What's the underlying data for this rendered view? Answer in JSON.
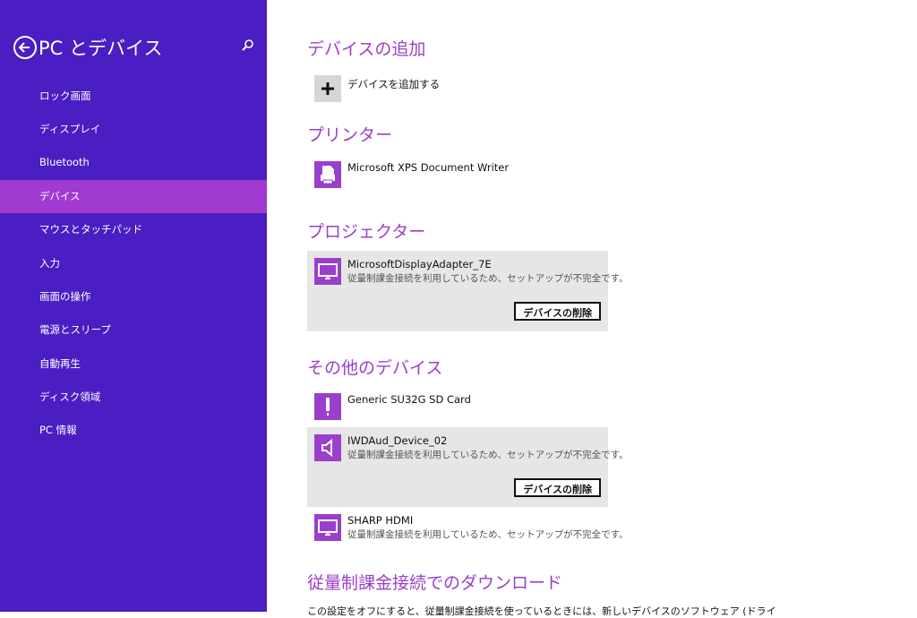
{
  "sidebar": {
    "title": "PC とデバイス",
    "items": [
      {
        "label": "ロック画面"
      },
      {
        "label": "ディスプレイ"
      },
      {
        "label": "Bluetooth"
      },
      {
        "label": "デバイス"
      },
      {
        "label": "マウスとタッチパッド"
      },
      {
        "label": "入力"
      },
      {
        "label": "画面の操作"
      },
      {
        "label": "電源とスリープ"
      },
      {
        "label": "自動再生"
      },
      {
        "label": "ディスク領域"
      },
      {
        "label": "PC 情報"
      }
    ]
  },
  "main": {
    "add_section": {
      "heading": "デバイスの追加",
      "add_label": "デバイスを追加する"
    },
    "printers": {
      "heading": "プリンター",
      "items": [
        {
          "name": "Microsoft XPS Document Writer"
        }
      ]
    },
    "projectors": {
      "heading": "プロジェクター",
      "items": [
        {
          "name": "MicrosoftDisplayAdapter_7E",
          "status": "従量制課金接続を利用しているため、セットアップが不完全です。",
          "button": "デバイスの削除"
        }
      ]
    },
    "other": {
      "heading": "その他のデバイス",
      "items": [
        {
          "name": "Generic SU32G SD Card"
        },
        {
          "name": "IWDAud_Device_02",
          "status": "従量制課金接続を利用しているため、セットアップが不完全です。",
          "button": "デバイスの削除"
        },
        {
          "name": "SHARP HDMI",
          "status": "従量制課金接続を利用しているため、セットアップが不完全です。"
        }
      ]
    },
    "metered": {
      "heading": "従量制課金接続でのダウンロード",
      "text": "この設定をオフにすると、従量制課金接続を使っているときには、新しいデバイスのソフトウェア (ドライ"
    }
  },
  "colors": {
    "sidebar_bg": "#4a1ec2",
    "sidebar_active": "#a03ad0",
    "accent": "#9a40c8",
    "selected_bg": "#e6e6e6"
  },
  "icons": {
    "back": "back-arrow-icon",
    "search": "search-icon",
    "add": "plus-icon",
    "printer": "printer-icon",
    "display": "monitor-icon",
    "sd_card": "sd-card-icon",
    "audio": "speaker-icon"
  }
}
